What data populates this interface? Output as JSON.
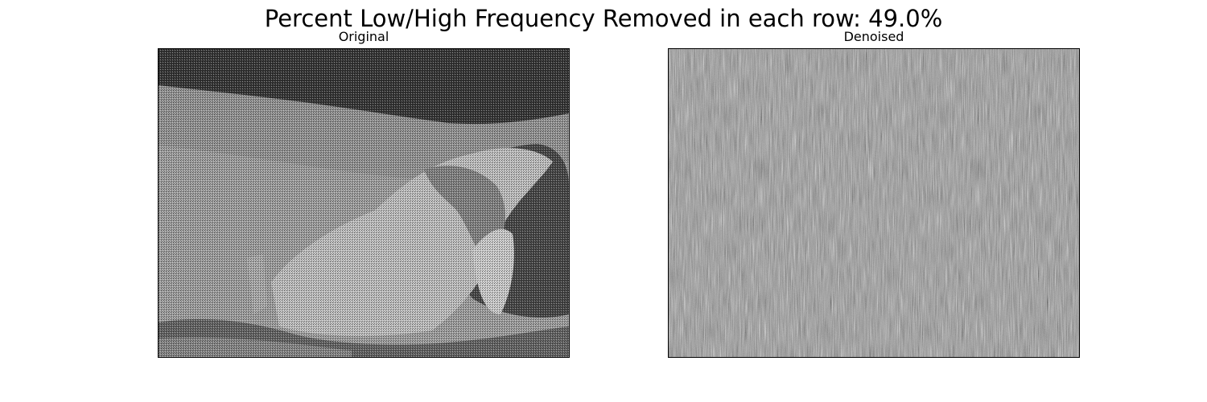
{
  "figure": {
    "suptitle": "Percent Low/High Frequency Removed in each row: 49.0%"
  },
  "panels": [
    {
      "title": "Original"
    },
    {
      "title": "Denoised"
    }
  ],
  "colors": {
    "background": "#ffffff",
    "frame": "#000000",
    "sky": "#3a3a3a",
    "ground": "#9a9a9a",
    "rock_light": "#c8c8c8",
    "rock_shadow": "#4a4a4a",
    "noise_gray": "#808080"
  }
}
